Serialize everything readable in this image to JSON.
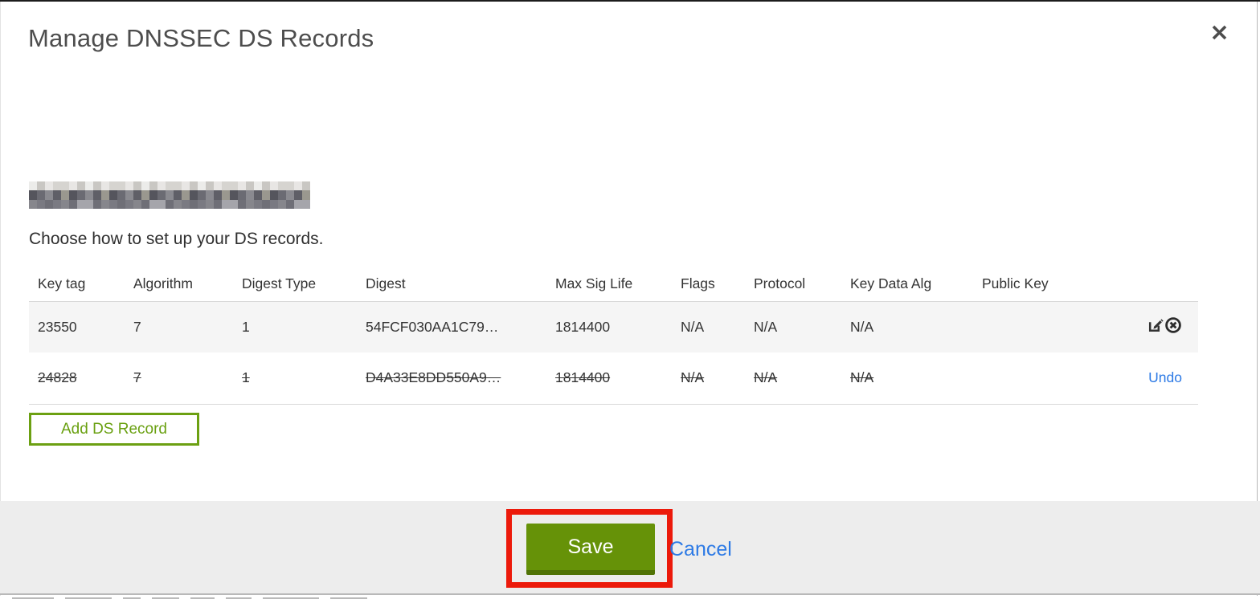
{
  "dialog": {
    "title": "Manage DNSSEC DS Records",
    "instruction": "Choose how to set up your DS records.",
    "domain": {
      "redacted": true
    }
  },
  "table": {
    "columns": [
      "Key tag",
      "Algorithm",
      "Digest Type",
      "Digest",
      "Max Sig Life",
      "Flags",
      "Protocol",
      "Key Data Alg",
      "Public Key"
    ],
    "rows": [
      {
        "cells": [
          "23550",
          "7",
          "1",
          "54FCF030AA1C79…",
          "1814400",
          "N/A",
          "N/A",
          "N/A",
          ""
        ],
        "deleted": false
      },
      {
        "cells": [
          "24828",
          "7",
          "1",
          "D4A33E8DD550A9…",
          "1814400",
          "N/A",
          "N/A",
          "N/A",
          ""
        ],
        "deleted": true
      }
    ],
    "undo_label": "Undo"
  },
  "buttons": {
    "add_ds_record": "Add DS Record",
    "save": "Save",
    "cancel": "Cancel"
  },
  "icons": {
    "close": "close-icon",
    "edit": "edit-icon",
    "delete": "delete-circle-icon"
  },
  "colors": {
    "accent_green": "#69a010",
    "save_green": "#669208",
    "save_green_dark": "#507306",
    "link_blue": "#2d7ae5",
    "annotation_red": "#ec1a0b",
    "row_gray": "#f5f5f5",
    "footer_gray": "#ededed"
  }
}
